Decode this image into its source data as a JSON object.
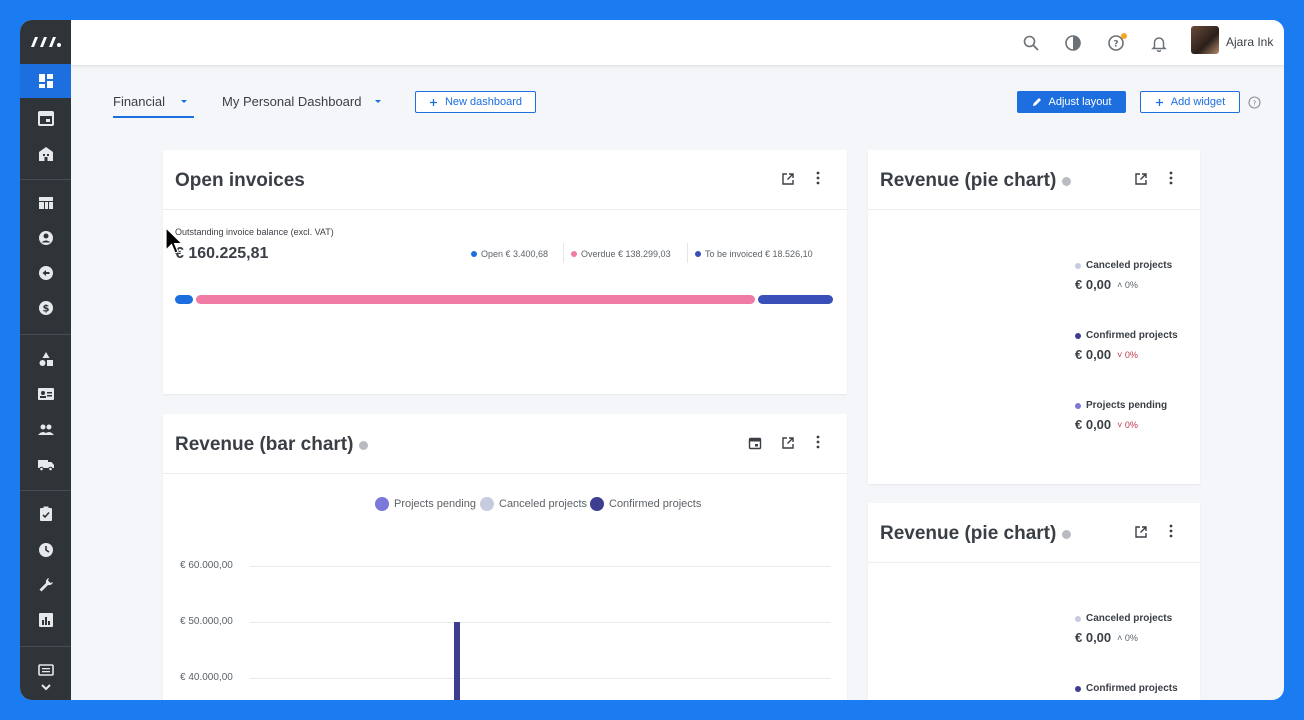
{
  "topbar": {
    "user_name": "Ajara Ink"
  },
  "dashboard_tabs": [
    {
      "label": "Financial"
    },
    {
      "label": "My Personal Dashboard"
    }
  ],
  "buttons": {
    "new_dashboard": "New dashboard",
    "adjust_layout": "Adjust layout",
    "add_widget": "Add widget"
  },
  "open_invoices": {
    "title": "Open invoices",
    "label": "Outstanding invoice balance (excl. VAT)",
    "total": "€ 160.225,81",
    "legend": [
      {
        "label": "Open € 3.400,68",
        "color": "#1d6fe0"
      },
      {
        "label": "Overdue € 138.299,03",
        "color": "#f07ba4"
      },
      {
        "label": "To be invoiced € 18.526,10",
        "color": "#3a4fb8"
      }
    ],
    "progress": {
      "open": 3400.68,
      "overdue": 138299.03,
      "to_be_invoiced": 18526.1
    }
  },
  "pie_widget_1": {
    "title": "Revenue (pie chart)",
    "items": [
      {
        "name": "Canceled projects",
        "value": "€ 0,00",
        "pct": "0%",
        "color": "#c7cbe0",
        "trend": "up"
      },
      {
        "name": "Confirmed projects",
        "value": "€ 0,00",
        "pct": "0%",
        "color": "#3d3e8f",
        "trend": "down"
      },
      {
        "name": "Projects pending",
        "value": "€ 0,00",
        "pct": "0%",
        "color": "#7b78d9",
        "trend": "down"
      }
    ]
  },
  "pie_widget_2": {
    "title": "Revenue (pie chart)",
    "items": [
      {
        "name": "Canceled projects",
        "value": "€ 0,00",
        "pct": "0%",
        "color": "#c7cbe0",
        "trend": "up"
      },
      {
        "name": "Confirmed projects",
        "color": "#3d3e8f"
      }
    ]
  },
  "bar_chart_widget": {
    "title": "Revenue (bar chart)"
  },
  "chart_data": {
    "type": "bar",
    "title": "Revenue (bar chart)",
    "series": [
      {
        "name": "Projects pending",
        "color": "#7b78d9"
      },
      {
        "name": "Canceled projects",
        "color": "#c7cbe0"
      },
      {
        "name": "Confirmed projects",
        "color": "#3d3e8f",
        "values": [
          50000
        ]
      }
    ],
    "y_ticks": [
      "€ 60.000,00",
      "€ 50.000,00",
      "€ 40.000,00"
    ],
    "y_tick_values": [
      60000,
      50000,
      40000
    ],
    "legend_position": "top",
    "grid": true
  },
  "colors": {
    "accent": "#1d6fe0",
    "sidebar": "#2f3439",
    "frame": "#1a7cf0"
  },
  "icons": {
    "sidebar": [
      "dashboard-icon",
      "calendar-icon",
      "building-icon",
      "table-icon",
      "user-icon",
      "sync-icon",
      "dollar-icon",
      "shapes-icon",
      "contact-card-icon",
      "team-icon",
      "truck-icon",
      "clipboard-check-icon",
      "clock-icon",
      "wrench-icon",
      "report-icon",
      "notes-icon"
    ]
  }
}
